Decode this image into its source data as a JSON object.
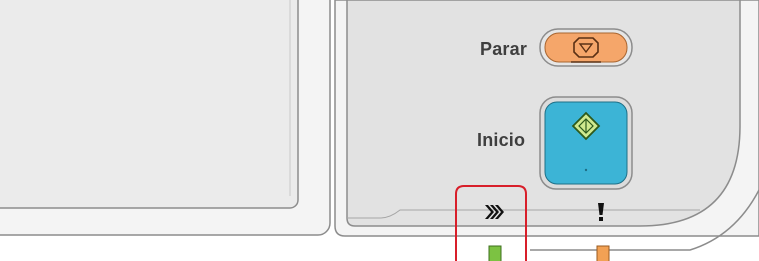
{
  "control_panel": {
    "stop": {
      "label": "Parar",
      "icon": "stop-icon",
      "color": "#f5a66a"
    },
    "start": {
      "label": "Inicio",
      "icon": "start-diamond-icon",
      "color": "#3cb4d6"
    },
    "indicators": [
      {
        "icon": "processing-chevrons-icon",
        "led_color": "#7cc242",
        "highlighted": true
      },
      {
        "icon": "attention-exclamation-icon",
        "led_color": "#f2a154",
        "highlighted": false
      }
    ],
    "highlight_color": "#d81f2a"
  }
}
